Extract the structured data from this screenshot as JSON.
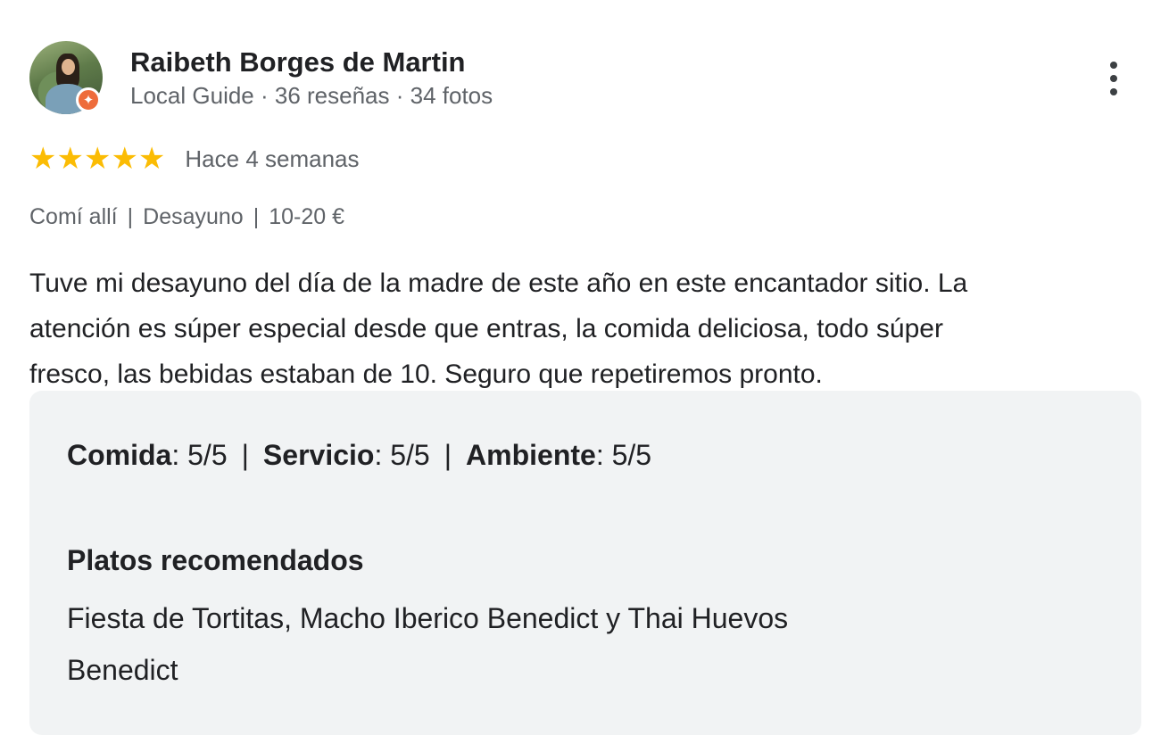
{
  "reviewer": {
    "name": "Raibeth Borges de Martin",
    "meta": "Local Guide · 36 reseñas · 34 fotos",
    "avatar_icon": "avatar-photo",
    "badge_icon": "local-guide-star-icon"
  },
  "menu": {
    "icon": "more-vert-icon"
  },
  "rating": {
    "stars": 5,
    "max": 5,
    "stars_text": "★★★★★",
    "star_color": "#fbbc04",
    "date": "Hace 4 semanas"
  },
  "details": {
    "items": [
      "Comí allí",
      "Desayuno",
      "10-20 €"
    ],
    "separator": "|"
  },
  "review": {
    "lines": [
      "Tuve mi desayuno del día de la madre de este año en este encantador sitio. La",
      "atención es súper especial desde que entras, la comida deliciosa, todo súper",
      "fresco, las bebidas estaban de 10. Seguro que repetiremos pronto."
    ]
  },
  "scores": {
    "items": [
      {
        "label": "Comida",
        "value": "5/5"
      },
      {
        "label": "Servicio",
        "value": "5/5"
      },
      {
        "label": "Ambiente",
        "value": "5/5"
      }
    ],
    "separator": "|"
  },
  "recommended": {
    "title": "Platos recomendados",
    "lines": [
      "Fiesta de Tortitas, Macho Iberico Benedict y Thai Huevos",
      "Benedict"
    ]
  },
  "colors": {
    "accent_star": "#fbbc04",
    "guide_badge": "#ee6c3b",
    "panel_bg": "#f1f3f4"
  }
}
